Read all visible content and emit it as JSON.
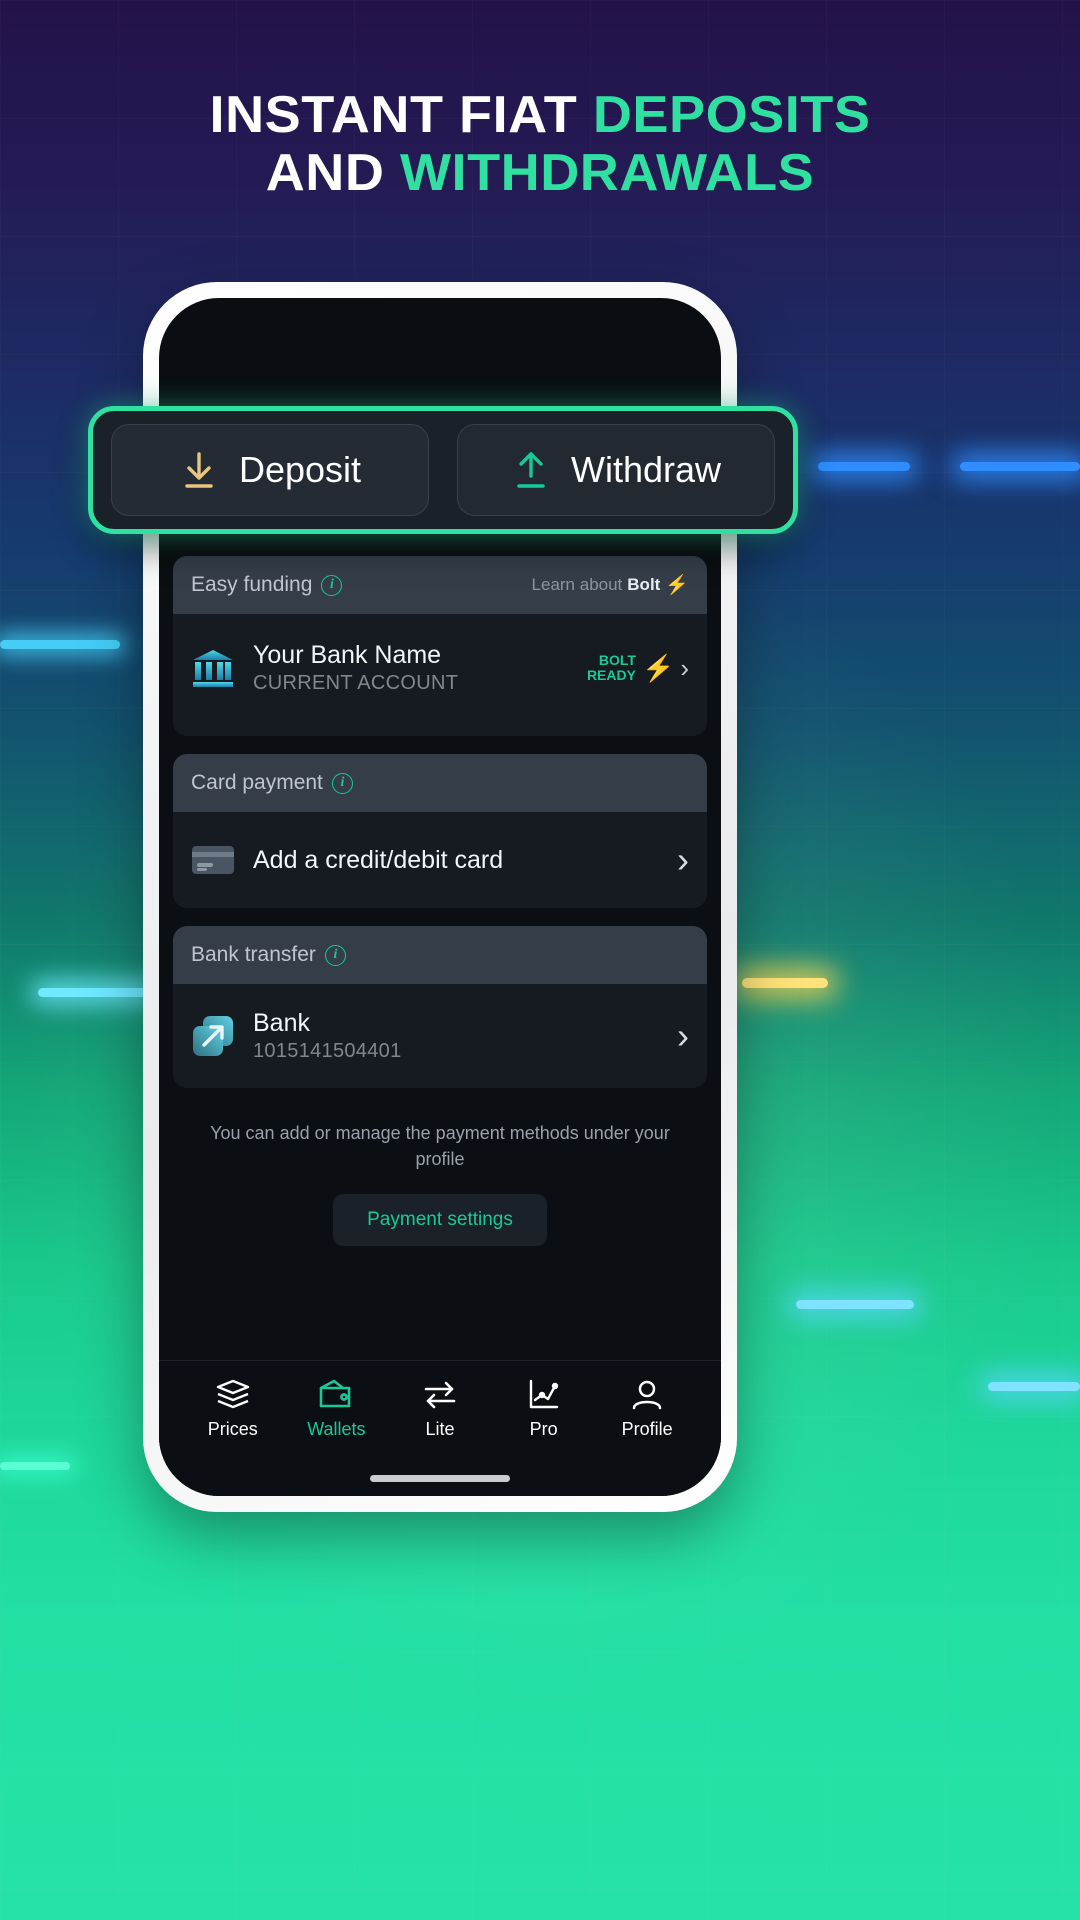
{
  "headline": {
    "line1_white": "INSTANT FIAT ",
    "line1_accent": "DEPOSITS",
    "line2_white": "AND ",
    "line2_accent": "WITHDRAWALS"
  },
  "colors": {
    "accent_green": "#2fe0a0",
    "bolt_green": "#18c99a",
    "deposit_arrow": "#e8c67d",
    "withdraw_arrow": "#18c99a",
    "bg_dark": "#0b0e12"
  },
  "switcher": {
    "deposit_label": "Deposit",
    "deposit_icon": "download-arrow-icon",
    "withdraw_label": "Withdraw",
    "withdraw_icon": "upload-arrow-icon"
  },
  "sections": [
    {
      "header": "Easy funding",
      "header_icon": "info-icon",
      "learn_prefix": "Learn about ",
      "learn_brand": "Bolt",
      "learn_icon": "bolt-icon",
      "item": {
        "icon": "bank-building-icon",
        "title": "Your Bank Name",
        "subtitle": "CURRENT ACCOUNT",
        "badge_line1": "BOLT",
        "badge_line2": "READY",
        "badge_icon": "bolt-icon",
        "chevron": "›"
      }
    },
    {
      "header": "Card payment",
      "header_icon": "info-icon",
      "item": {
        "icon": "credit-card-icon",
        "title": "Add a credit/debit card",
        "subtitle": "",
        "chevron": "›"
      }
    },
    {
      "header": "Bank transfer",
      "header_icon": "info-icon",
      "item": {
        "icon": "transfer-arrow-icon",
        "title": "Bank",
        "subtitle": "1015141504401",
        "chevron": "›"
      }
    }
  ],
  "footer": {
    "note": "You can add or manage the payment methods under your profile",
    "button_label": "Payment settings"
  },
  "tabbar": {
    "items": [
      {
        "label": "Prices",
        "icon": "layers-icon",
        "active": false
      },
      {
        "label": "Wallets",
        "icon": "wallet-icon",
        "active": true
      },
      {
        "label": "Lite",
        "icon": "swap-icon",
        "active": false
      },
      {
        "label": "Pro",
        "icon": "chart-icon",
        "active": false
      },
      {
        "label": "Profile",
        "icon": "person-icon",
        "active": false
      }
    ]
  }
}
